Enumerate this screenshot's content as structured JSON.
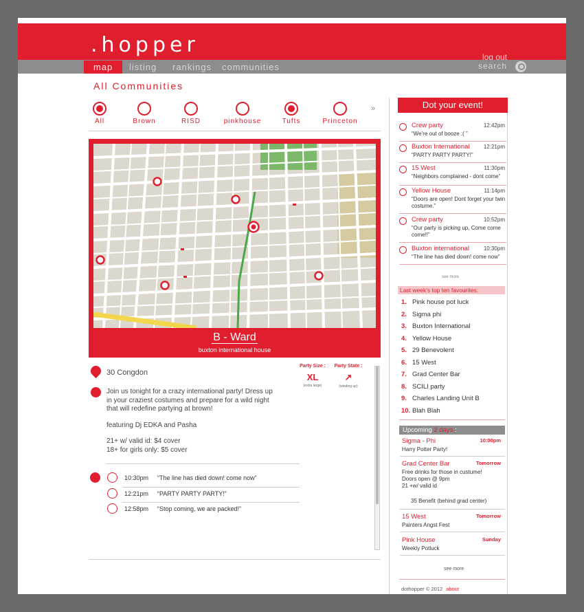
{
  "header": {
    "brand": ".hopper",
    "logout": "log out"
  },
  "nav": {
    "items": [
      "map",
      "listing",
      "rankings",
      "communities"
    ],
    "search": "search"
  },
  "page_title": "All Communities",
  "communities": [
    {
      "label": "All",
      "selected": true
    },
    {
      "label": "Brown",
      "selected": false
    },
    {
      "label": "RISD",
      "selected": false
    },
    {
      "label": "pinkhouse",
      "selected": false
    },
    {
      "label": "Tufts",
      "selected": true
    },
    {
      "label": "Princeton",
      "selected": false
    }
  ],
  "communities_more": "»",
  "map_panel": {
    "title": "B - Ward",
    "subtitle": "buxton international house"
  },
  "detail": {
    "address": "30 Congdon",
    "description": [
      "Join us tonight for a crazy international party! Dress up in your craziest costumes and prepare for a wild night that will redefine partying at brown!",
      "featuring Dj EDKA and Pasha",
      "21+ w/ valid id: $4 cover\n18+ for girls only: $5 cover"
    ],
    "party_size_label": "Party Size :",
    "party_size_value": "XL",
    "party_size_note": "(extra large)",
    "party_state_label": "Party State :",
    "party_state_value": "↗",
    "party_state_note": "(winding up)",
    "feed": [
      {
        "time": "10:30pm",
        "msg": "“The line has died down! come now”",
        "icon": "trend-up-icon"
      },
      {
        "time": "12:21pm",
        "msg": "“PARTY PARTY PARTY!”",
        "icon": "chat-icon"
      },
      {
        "time": "12:58pm",
        "msg": "“Stop coming, we are packed!”",
        "icon": "close-icon"
      }
    ]
  },
  "sidebar": {
    "dot_button": "Dot your event!",
    "events": [
      {
        "name": "Crew party",
        "time": "12:42pm",
        "quote": "“We’re out of booze :( ”"
      },
      {
        "name": "Buxton International",
        "time": "12:21pm",
        "quote": "“PARTY PARTY PARTY!”"
      },
      {
        "name": "15 West",
        "time": "11:30pm",
        "quote": "“Neighbors complained - dont come”"
      },
      {
        "name": "Yellow House",
        "time": "11:14pm",
        "quote": "“Doors are open! Dont forget your twin costume.”"
      },
      {
        "name": "Crew party",
        "time": "10:52pm",
        "quote": "“Our party is picking up, Come come come!!”"
      },
      {
        "name": "Buxton international",
        "time": "10:30pm",
        "quote": "“The line has died down! come now”"
      }
    ],
    "events_more": "see more",
    "top_title": "Last week's top ten favourites:",
    "top_ten": [
      "Pink house pot luck",
      "Sigma phi",
      "Buxton International",
      "Yellow House",
      "29 Benevolent",
      "15 West",
      "Grad Center Bar",
      "SCILI party",
      "Charles Landing Unit B",
      "Blah Blah"
    ],
    "upcoming_label": "Upcoming",
    "upcoming_range": "2 days",
    "upcoming_colon": ":",
    "upcoming": [
      {
        "name": "Sigma - Phi",
        "when": "10:00pm",
        "desc": "Harry Potter Party!"
      },
      {
        "name": "Grad Center Bar",
        "when": "Tomorrow",
        "desc": "Free drinks for those in custume!\nDoors open @ 9pm\n21 +w/ valid id",
        "location": "35 Benefit (behind grad center)"
      },
      {
        "name": "15 West",
        "when": "Tomorrow",
        "desc": "Painters Angst Fest"
      },
      {
        "name": "Pink House",
        "when": "Sunday",
        "desc": "Weekly Potluck"
      }
    ],
    "upcoming_more": "see more",
    "footer": "dothopper © 2012",
    "footer_link": "about"
  },
  "colors": {
    "accent": "#e01e2d",
    "nav": "#8d8d8d",
    "map_bg": "#ddd8cd"
  }
}
